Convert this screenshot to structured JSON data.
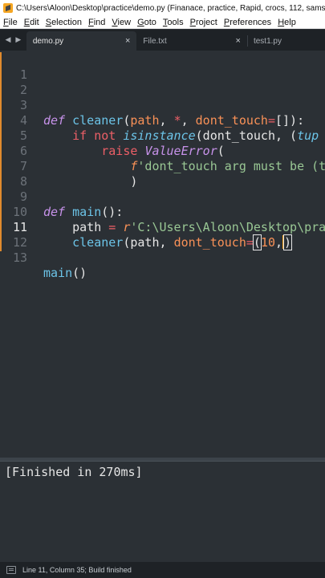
{
  "window": {
    "title": "C:\\Users\\Aloon\\Desktop\\practice\\demo.py (Finanace, practice, Rapid, crocs, 112, samsung"
  },
  "menu": [
    {
      "u": "F",
      "rest": "ile"
    },
    {
      "u": "E",
      "rest": "dit"
    },
    {
      "u": "S",
      "rest": "election"
    },
    {
      "u": "F",
      "rest": "ind"
    },
    {
      "u": "V",
      "rest": "iew"
    },
    {
      "u": "G",
      "rest": "oto"
    },
    {
      "u": "T",
      "rest": "ools"
    },
    {
      "u": "P",
      "rest": "roject"
    },
    {
      "u": "P",
      "rest": "references"
    },
    {
      "u": "H",
      "rest": "elp"
    }
  ],
  "tabs": {
    "active": {
      "label": "demo.py",
      "close": "×"
    },
    "items": [
      {
        "label": "File.txt",
        "close": "×"
      },
      {
        "label": "test1.py"
      }
    ],
    "arrows": {
      "left": "◀",
      "right": "▶"
    }
  },
  "editor": {
    "current_line": 11,
    "line_numbers": [
      "1",
      "2",
      "3",
      "4",
      "5",
      "6",
      "7",
      "8",
      "9",
      "10",
      "11",
      "12",
      "13"
    ],
    "code": {
      "l3": {
        "def": "def",
        "name": "cleaner",
        "p1": "(",
        "path": "path",
        "c1": ", ",
        "star": "*",
        "c2": ", ",
        "dt": "dont_touch",
        "eq": "=",
        "rest": "[]):"
      },
      "l4": {
        "if": "if",
        "not": "not",
        "isinstance": "isinstance",
        "a": "(dont_touch, (",
        "tup": "tup"
      },
      "l5": {
        "raise": "raise",
        "err": "ValueError",
        "p": "("
      },
      "l6": {
        "f": "f",
        "str": "'dont_touch arg must be (t"
      },
      "l7": {
        "p": ")"
      },
      "l9": {
        "def": "def",
        "name": "main",
        "rest": "():"
      },
      "l10": {
        "path": "path ",
        "eq": "=",
        "r": "r",
        "str": "'C:\\Users\\Aloon\\Desktop\\pra"
      },
      "l11": {
        "call": "cleaner",
        "a": "(path, ",
        "dt": "dont_touch",
        "eq": "=",
        "b": "(",
        "num": "10",
        "c": ",",
        "d": ")"
      },
      "l13": {
        "call": "main",
        "rest": "()"
      }
    }
  },
  "output": {
    "text": "[Finished in 270ms]"
  },
  "status": {
    "text": "Line 11, Column 35; Build finished"
  },
  "colors": {
    "accent": "#e08a2d",
    "background": "#2b3035",
    "keyword": "#c792ea",
    "function": "#6cc4e8",
    "string": "#99c794",
    "operator": "#ec5f67"
  }
}
